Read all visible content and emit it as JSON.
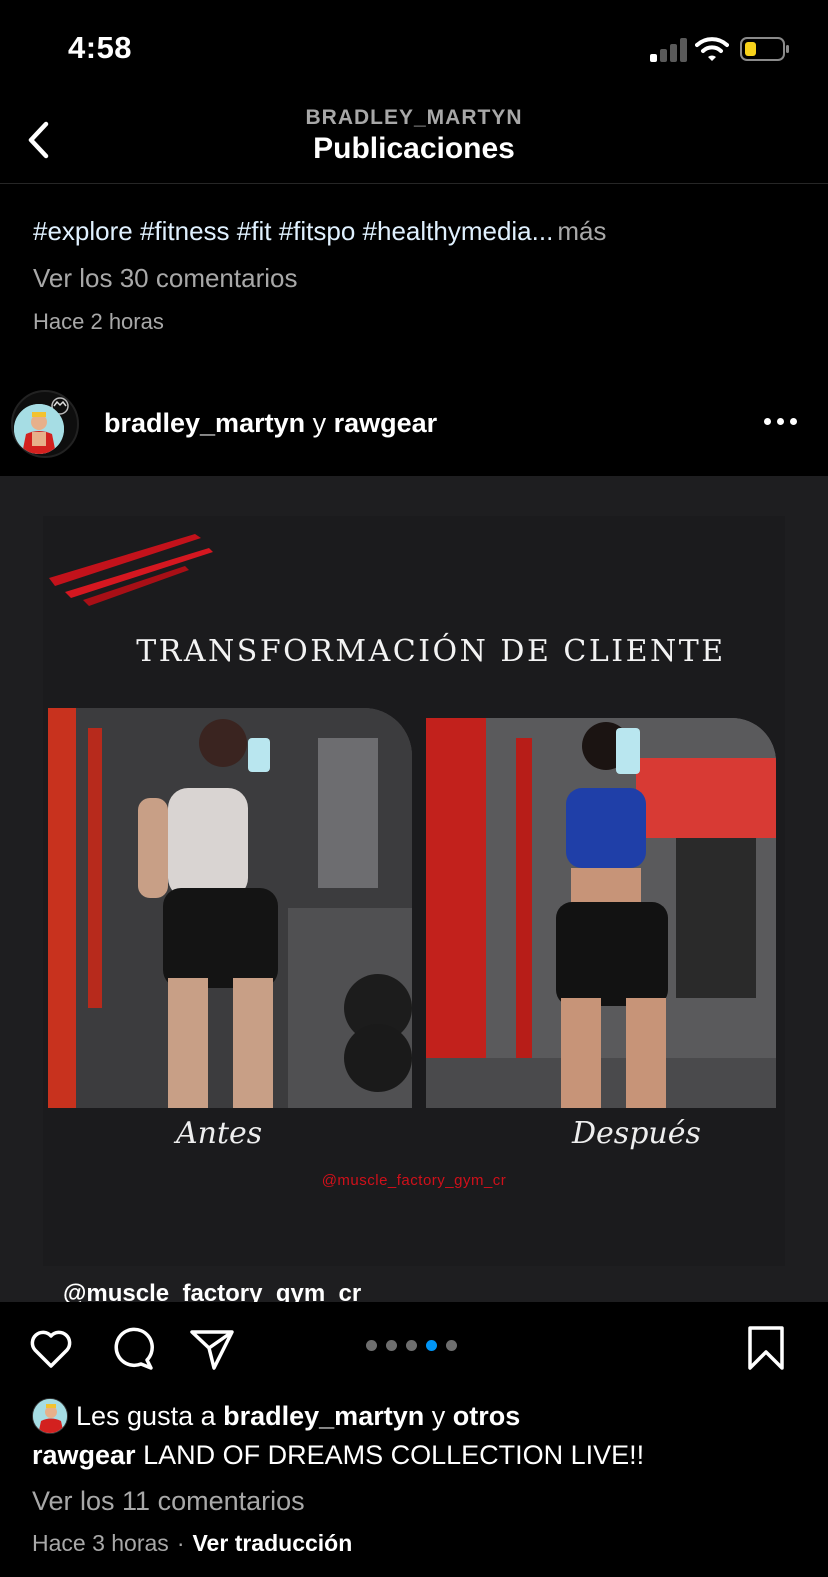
{
  "status_bar": {
    "time": "4:58"
  },
  "header": {
    "username": "BRADLEY_MARTYN",
    "title": "Publicaciones"
  },
  "previous_post": {
    "caption": "#explore #fitness #fit #fitspo #healthymedia...",
    "more": "más",
    "view_comments": "Ver los 30 comentarios",
    "time": "Hace 2 horas"
  },
  "post": {
    "author": "bradley_martyn",
    "connector": "y",
    "collaborator": "rawgear",
    "media": {
      "title": "TRANSFORMACIÓN DE CLIENTE",
      "label_before": "Antes",
      "label_after": "Después",
      "gym_handle": "@muscle_factory_gym_cr",
      "tag_overlay": "@muscle_factory_gym_cr"
    },
    "carousel": {
      "count": 5,
      "active_index": 3
    },
    "likes": {
      "prefix": "Les gusta a",
      "user": "bradley_martyn",
      "connector": "y",
      "others": "otros"
    },
    "caption": {
      "user": "rawgear",
      "text": "LAND OF DREAMS COLLECTION LIVE!!"
    },
    "view_comments": "Ver los 11 comentarios",
    "time": "Hace 3 horas",
    "separator": "·",
    "translate": "Ver traducción"
  },
  "colors": {
    "background": "#000000",
    "muted": "#a8a8a8",
    "hashtag": "#e0f1ff",
    "accent_blue": "#0095f6",
    "accent_red": "#d0101a"
  },
  "icons": [
    "back-chevron-icon",
    "more-horizontal-icon",
    "heart-icon",
    "comment-icon",
    "share-icon",
    "bookmark-icon"
  ]
}
